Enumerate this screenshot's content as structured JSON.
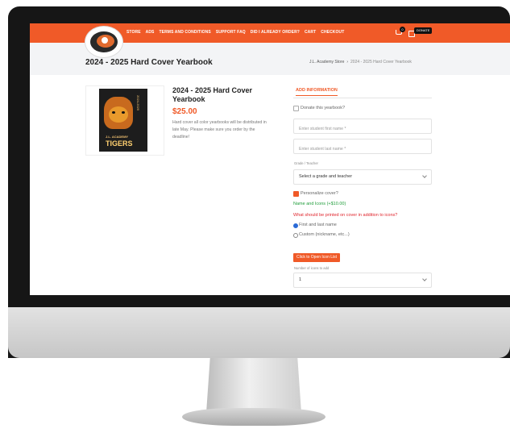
{
  "nav": {
    "links": [
      "STORE",
      "ADS",
      "TERMS AND CONDITIONS",
      "SUPPORT FAQ",
      "DID I ALREADY ORDER?",
      "CART",
      "CHECKOUT"
    ],
    "cart_count": "0",
    "donate_label": "DONATE"
  },
  "page": {
    "title": "2024 - 2025 Hard Cover Yearbook",
    "breadcrumb_home": "J.L. Academy Store",
    "breadcrumb_sep": "›",
    "breadcrumb_current": "2024 - 2025 Hard Cover Yearbook"
  },
  "product": {
    "cover_year": "2024-2025",
    "cover_school": "J.L. ACADEMY",
    "cover_team": "TIGERS",
    "title": "2024 - 2025 Hard Cover Yearbook",
    "price": "$25.00",
    "description": "Hard cover all color yearbooks will be distributed in late May. Please make sure you order by the deadline!"
  },
  "form": {
    "tab_label": "ADD INFORMATION",
    "donate_label": "Donate this yearbook?",
    "first_name_placeholder": "Enter student first name *",
    "last_name_placeholder": "Enter student last name *",
    "grade_label": "Grade / Teacher",
    "grade_value": "Select a grade and teacher",
    "personalize_label": "Personalize cover?",
    "personalize_checked": true,
    "name_icons_label": "Name and Icons (+$10.00)",
    "question_label": "What should be printed on cover in addition to icons?",
    "radio_first_last": "First and last name",
    "radio_custom": "Custom (nickname, etc...)",
    "open_icon_button": "Click to Open Icon List",
    "icons_count_label": "Number of icons to add",
    "icons_count_value": "1"
  },
  "colors": {
    "accent": "#f05a28",
    "green": "#1f9d3a",
    "red": "#e0262e"
  }
}
